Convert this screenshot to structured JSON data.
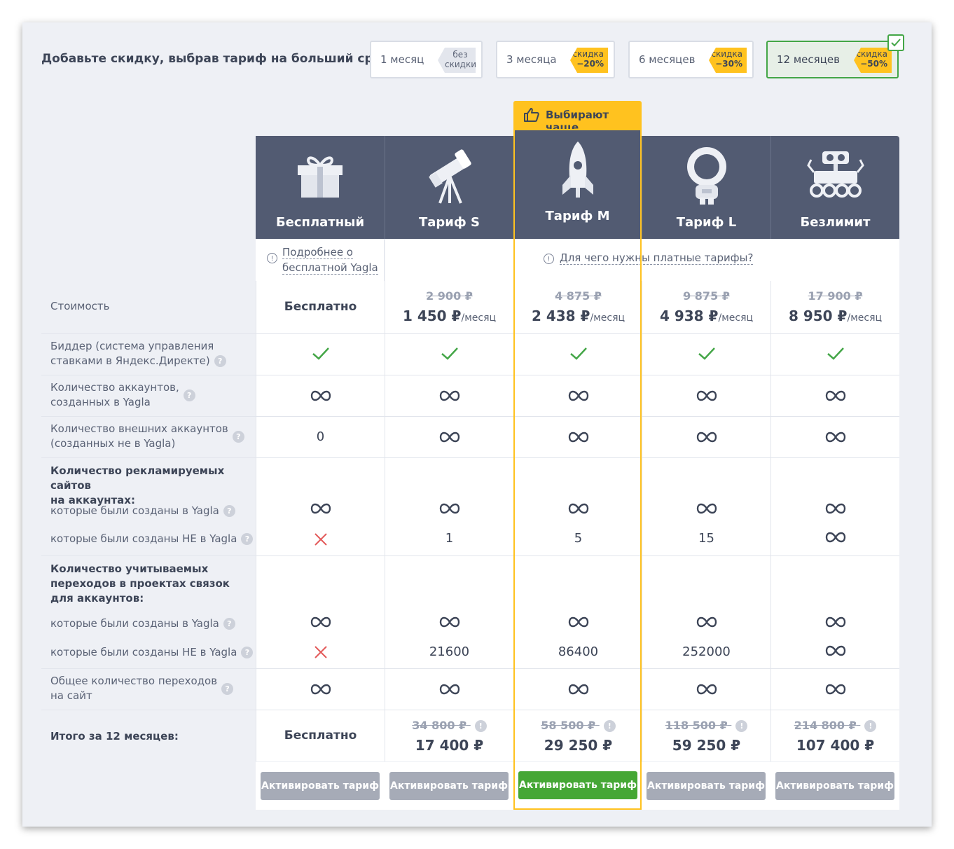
{
  "header": {
    "title": "Добавьте скидку, выбрав тариф на больший срок",
    "periods": [
      {
        "label": "1 месяц",
        "badge1": "без",
        "badge2": "скидки"
      },
      {
        "label": "3 месяца",
        "badge1": "скидка",
        "badge2": "−20%"
      },
      {
        "label": "6 месяцев",
        "badge1": "скидка",
        "badge2": "−30%"
      },
      {
        "label": "12 месяцев",
        "badge1": "скидка",
        "badge2": "−50%"
      }
    ],
    "selected_period": "12 месяцев"
  },
  "popular_label": "Выбирают чаще",
  "plans": [
    {
      "name": "Бесплатный",
      "icon": "gift-icon"
    },
    {
      "name": "Тариф S",
      "icon": "telescope-icon"
    },
    {
      "name": "Тариф M",
      "icon": "rocket-icon"
    },
    {
      "name": "Тариф L",
      "icon": "astronaut-icon"
    },
    {
      "name": "Безлимит",
      "icon": "rover-icon"
    }
  ],
  "info": {
    "free_line1": "Подробнее о",
    "free_line2": "бесплатной Yagla",
    "paid": "Для чего нужны платные тарифы?"
  },
  "rows": {
    "cost": {
      "label": "Стоимость",
      "free": "Бесплатно",
      "old": [
        "2 900 ₽",
        "4 875 ₽",
        "9 875 ₽",
        "17 900 ₽"
      ],
      "price": [
        "1 450 ₽",
        "2 438 ₽",
        "4 938 ₽",
        "8 950 ₽"
      ],
      "per": "/месяц"
    },
    "bidder": {
      "line1": "Биддер (система управления",
      "line2": "ставками в Яндекс.Директе)"
    },
    "accounts": {
      "line1": "Количество аккаунтов,",
      "line2": "созданных в Yagla"
    },
    "external": {
      "line1": "Количество внешних аккаунтов",
      "line2": "(созданных не в Yagla)",
      "free_value": "0"
    },
    "sites": {
      "line1": "Количество рекламируемых сайтов",
      "line2": "на аккаунтах:",
      "sub1": "которые были созданы в Yagla",
      "sub2": "которые были созданы НЕ в Yagla",
      "sub2_values": [
        "1",
        "5",
        "15"
      ]
    },
    "transitions": {
      "line1": "Количество учитываемых",
      "line2": "переходов в проектах связок",
      "line3": "для аккаунтов:",
      "sub1": "которые были созданы в Yagla",
      "sub2": "которые были созданы НЕ в Yagla",
      "sub2_values": [
        "21600",
        "86400",
        "252000"
      ]
    },
    "total_transitions": {
      "line1": "Общее количество переходов",
      "line2": "на сайт"
    },
    "total": {
      "label": "Итого за 12 месяцев:",
      "free": "Бесплатно",
      "old": [
        "34 800 ₽",
        "58 500 ₽",
        "118 500 ₽",
        "214 800 ₽"
      ],
      "price": [
        "17 400 ₽",
        "29 250 ₽",
        "59 250 ₽",
        "107 400 ₽"
      ]
    }
  },
  "button_label": "Активировать тариф",
  "colors": {
    "accent_yellow": "#ffc21f",
    "accent_green": "#45a735",
    "header_bg": "#525b72"
  }
}
